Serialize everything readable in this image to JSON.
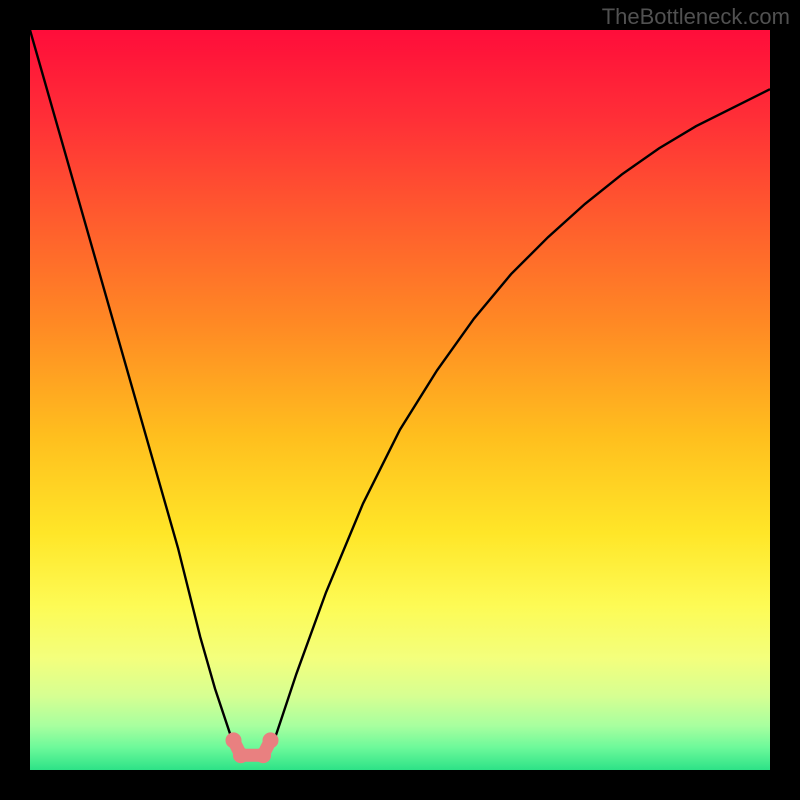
{
  "watermark": "TheBottleneck.com",
  "chart_data": {
    "type": "line",
    "title": "",
    "xlabel": "",
    "ylabel": "",
    "xlim": [
      0,
      100
    ],
    "ylim": [
      0,
      100
    ],
    "series": [
      {
        "name": "bottleneck-curve",
        "x": [
          0,
          4,
          8,
          12,
          16,
          20,
          23,
          25,
          27,
          28,
          29,
          30,
          31,
          32,
          33,
          34,
          36,
          40,
          45,
          50,
          55,
          60,
          65,
          70,
          75,
          80,
          85,
          90,
          95,
          100
        ],
        "y": [
          100,
          86,
          72,
          58,
          44,
          30,
          18,
          11,
          5,
          3,
          2,
          2,
          2,
          2.5,
          4,
          7,
          13,
          24,
          36,
          46,
          54,
          61,
          67,
          72,
          76.5,
          80.5,
          84,
          87,
          89.5,
          92
        ]
      }
    ],
    "markers": [
      {
        "x": 27.5,
        "y": 4,
        "name": "marker-left-top"
      },
      {
        "x": 28.5,
        "y": 2,
        "name": "marker-left-bottom"
      },
      {
        "x": 31.5,
        "y": 2,
        "name": "marker-right-bottom"
      },
      {
        "x": 32.5,
        "y": 4,
        "name": "marker-right-top"
      }
    ],
    "marker_segment": {
      "x": [
        27.5,
        28.5,
        30,
        31.5,
        32.5
      ],
      "y": [
        4,
        2,
        2,
        2,
        4
      ]
    },
    "background_gradient": {
      "direction": "vertical",
      "stops": [
        {
          "offset": 0,
          "color": "#ff0d3a"
        },
        {
          "offset": 0.12,
          "color": "#ff2f37"
        },
        {
          "offset": 0.25,
          "color": "#ff5a2e"
        },
        {
          "offset": 0.4,
          "color": "#ff8a24"
        },
        {
          "offset": 0.55,
          "color": "#ffbf1e"
        },
        {
          "offset": 0.68,
          "color": "#ffe628"
        },
        {
          "offset": 0.78,
          "color": "#fdfb56"
        },
        {
          "offset": 0.85,
          "color": "#f3ff7d"
        },
        {
          "offset": 0.9,
          "color": "#d6ff92"
        },
        {
          "offset": 0.94,
          "color": "#a8ff9f"
        },
        {
          "offset": 0.97,
          "color": "#6cf99a"
        },
        {
          "offset": 1.0,
          "color": "#2de287"
        }
      ]
    },
    "colors": {
      "curve": "#000000",
      "marker": "#e98080",
      "frame": "#000000"
    }
  }
}
